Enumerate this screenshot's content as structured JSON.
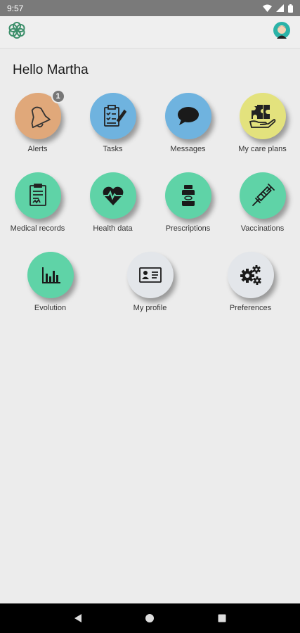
{
  "status_bar": {
    "time": "9:57"
  },
  "greeting": "Hello Martha",
  "colors": {
    "orange": "#e0a87a",
    "blue": "#6fb3df",
    "yellow": "#e3e27d",
    "green": "#5fd3a7",
    "grey": "#e3e6ea"
  },
  "tiles": [
    {
      "label": "Alerts",
      "icon": "bell-icon",
      "color": "orange",
      "badge": "1"
    },
    {
      "label": "Tasks",
      "icon": "clipboard-icon",
      "color": "blue"
    },
    {
      "label": "Messages",
      "icon": "chat-bubble-icon",
      "color": "blue"
    },
    {
      "label": "My care plans",
      "icon": "care-plan-icon",
      "color": "yellow"
    },
    {
      "label": "Medical records",
      "icon": "medical-record-icon",
      "color": "green"
    },
    {
      "label": "Health data",
      "icon": "heart-rate-icon",
      "color": "green"
    },
    {
      "label": "Prescriptions",
      "icon": "pill-bottle-icon",
      "color": "green"
    },
    {
      "label": "Vaccinations",
      "icon": "syringe-icon",
      "color": "green"
    },
    {
      "label": "Evolution",
      "icon": "bar-chart-icon",
      "color": "green"
    },
    {
      "label": "My profile",
      "icon": "id-card-icon",
      "color": "grey"
    },
    {
      "label": "Preferences",
      "icon": "gears-icon",
      "color": "grey"
    }
  ]
}
